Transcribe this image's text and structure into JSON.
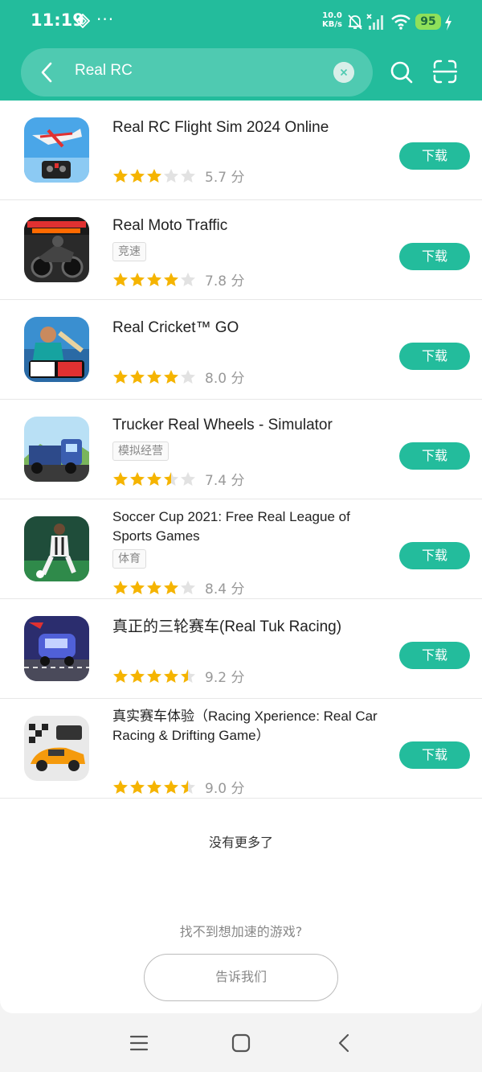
{
  "status": {
    "time": "11:19",
    "net_speed_value": "10.0",
    "net_speed_unit": "KB/s",
    "battery": "95",
    "icons": [
      "diamond-icon",
      "more-dots-icon",
      "mute-bell-icon",
      "signal-icon",
      "wifi-icon",
      "battery-icon",
      "charging-bolt-icon"
    ],
    "dots": "···"
  },
  "search": {
    "query": "Real RC",
    "icons": [
      "back-arrow-icon",
      "clear-icon",
      "search-icon",
      "scan-icon"
    ]
  },
  "results": [
    {
      "title": "Real RC Flight Sim 2024 Online",
      "tag": "",
      "stars": 3,
      "score": "5.7 分",
      "button": "下载",
      "icon": "rc-plane-icon"
    },
    {
      "title": "Real Moto Traffic",
      "tag": "竞速",
      "stars": 4,
      "score": "7.8 分",
      "button": "下载",
      "icon": "moto-traffic-icon"
    },
    {
      "title": "Real Cricket™ GO",
      "tag": "",
      "stars": 4,
      "score": "8.0 分",
      "button": "下载",
      "icon": "cricket-icon"
    },
    {
      "title": "Trucker Real Wheels - Simulator",
      "tag": "模拟经营",
      "stars": 3.5,
      "score": "7.4 分",
      "button": "下载",
      "icon": "truck-icon"
    },
    {
      "title": "Soccer Cup 2021: Free Real League of Sports Games",
      "tag": "体育",
      "stars": 4,
      "score": "8.4 分",
      "button": "下载",
      "icon": "soccer-icon"
    },
    {
      "title": "真正的三轮赛车(Real Tuk Racing)",
      "tag": "",
      "stars": 4.5,
      "score": "9.2 分",
      "button": "下载",
      "icon": "tuk-racing-icon"
    },
    {
      "title": "真实赛车体验（Racing Xperience: Real Car Racing & Drifting Game）",
      "tag": "",
      "stars": 4.5,
      "score": "9.0 分",
      "button": "下载",
      "icon": "racing-car-icon"
    }
  ],
  "footer": {
    "no_more": "没有更多了",
    "cant_find": "找不到想加速的游戏?",
    "tell_us": "告诉我们"
  },
  "colors": {
    "accent": "#23bc9c",
    "star": "#f5b400",
    "star_empty": "#e2e2e2"
  }
}
